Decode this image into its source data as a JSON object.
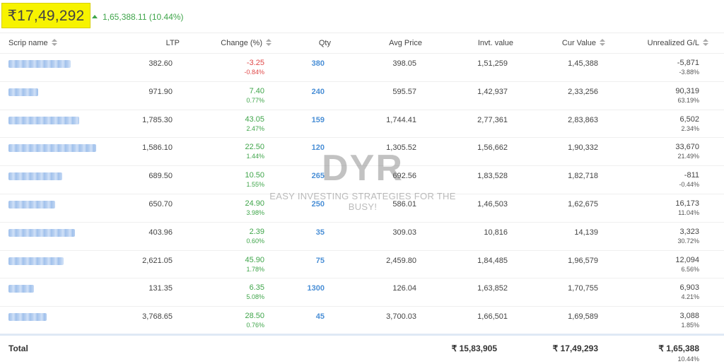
{
  "summary": {
    "current_total": "₹17,49,292",
    "day_change": "1,65,388.11 (10.44%)"
  },
  "columns": {
    "scrip": "Scrip name",
    "ltp": "LTP",
    "change": "Change (%)",
    "qty": "Qty",
    "avg": "Avg Price",
    "inv": "Invt. value",
    "cur": "Cur Value",
    "unr": "Unrealized G/L"
  },
  "rows": [
    {
      "ltp": "382.60",
      "chg": "-3.25",
      "chg_pct": "-0.84%",
      "chg_dir": "down",
      "qty": "380",
      "avg": "398.05",
      "inv": "1,51,259",
      "cur": "1,45,388",
      "unr": "-5,871",
      "unr_pct": "-3.88%"
    },
    {
      "ltp": "971.90",
      "chg": "7.40",
      "chg_pct": "0.77%",
      "chg_dir": "up",
      "qty": "240",
      "avg": "595.57",
      "inv": "1,42,937",
      "cur": "2,33,256",
      "unr": "90,319",
      "unr_pct": "63.19%"
    },
    {
      "ltp": "1,785.30",
      "chg": "43.05",
      "chg_pct": "2.47%",
      "chg_dir": "up",
      "qty": "159",
      "avg": "1,744.41",
      "inv": "2,77,361",
      "cur": "2,83,863",
      "unr": "6,502",
      "unr_pct": "2.34%"
    },
    {
      "ltp": "1,586.10",
      "chg": "22.50",
      "chg_pct": "1.44%",
      "chg_dir": "up",
      "qty": "120",
      "avg": "1,305.52",
      "inv": "1,56,662",
      "cur": "1,90,332",
      "unr": "33,670",
      "unr_pct": "21.49%"
    },
    {
      "ltp": "689.50",
      "chg": "10.50",
      "chg_pct": "1.55%",
      "chg_dir": "up",
      "qty": "265",
      "avg": "692.56",
      "inv": "1,83,528",
      "cur": "1,82,718",
      "unr": "-811",
      "unr_pct": "-0.44%"
    },
    {
      "ltp": "650.70",
      "chg": "24.90",
      "chg_pct": "3.98%",
      "chg_dir": "up",
      "qty": "250",
      "avg": "586.01",
      "inv": "1,46,503",
      "cur": "1,62,675",
      "unr": "16,173",
      "unr_pct": "11.04%"
    },
    {
      "ltp": "403.96",
      "chg": "2.39",
      "chg_pct": "0.60%",
      "chg_dir": "up",
      "qty": "35",
      "avg": "309.03",
      "inv": "10,816",
      "cur": "14,139",
      "unr": "3,323",
      "unr_pct": "30.72%"
    },
    {
      "ltp": "2,621.05",
      "chg": "45.90",
      "chg_pct": "1.78%",
      "chg_dir": "up",
      "qty": "75",
      "avg": "2,459.80",
      "inv": "1,84,485",
      "cur": "1,96,579",
      "unr": "12,094",
      "unr_pct": "6.56%"
    },
    {
      "ltp": "131.35",
      "chg": "6.35",
      "chg_pct": "5.08%",
      "chg_dir": "up",
      "qty": "1300",
      "avg": "126.04",
      "inv": "1,63,852",
      "cur": "1,70,755",
      "unr": "6,903",
      "unr_pct": "4.21%"
    },
    {
      "ltp": "3,768.65",
      "chg": "28.50",
      "chg_pct": "0.76%",
      "chg_dir": "up",
      "qty": "45",
      "avg": "3,700.03",
      "inv": "1,66,501",
      "cur": "1,69,589",
      "unr": "3,088",
      "unr_pct": "1.85%"
    }
  ],
  "total": {
    "label": "Total",
    "inv": "₹ 15,83,905",
    "cur": "₹ 17,49,293",
    "unr": "₹ 1,65,388",
    "unr_pct": "10.44%"
  },
  "watermark": {
    "brand": "DYR",
    "tagline": "EASY INVESTING STRATEGIES FOR THE BUSY!"
  },
  "colors": {
    "gain": "#3fa54a",
    "loss": "#e04848",
    "qty": "#4a8fd6",
    "highlight": "#f7f300"
  },
  "icons": [
    "up-arrow-icon",
    "sort-icon"
  ]
}
